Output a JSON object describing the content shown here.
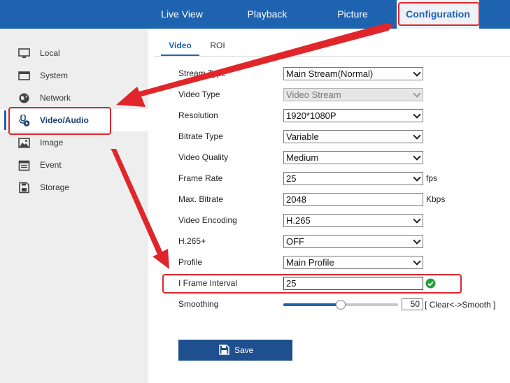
{
  "topnav": {
    "items": [
      {
        "label": "Live View"
      },
      {
        "label": "Playback"
      },
      {
        "label": "Picture"
      },
      {
        "label": "Configuration"
      }
    ]
  },
  "sidebar": {
    "items": [
      {
        "label": "Local",
        "icon": "monitor-icon"
      },
      {
        "label": "System",
        "icon": "system-window-icon"
      },
      {
        "label": "Network",
        "icon": "globe-icon"
      },
      {
        "label": "Video/Audio",
        "icon": "video-audio-icon"
      },
      {
        "label": "Image",
        "icon": "image-icon"
      },
      {
        "label": "Event",
        "icon": "calendar-icon"
      },
      {
        "label": "Storage",
        "icon": "storage-icon"
      }
    ]
  },
  "tabs": [
    {
      "label": "Video"
    },
    {
      "label": "ROI"
    }
  ],
  "form": {
    "stream_type": {
      "label": "Stream Type",
      "value": "Main Stream(Normal)"
    },
    "video_type": {
      "label": "Video Type",
      "value": "Video Stream"
    },
    "resolution": {
      "label": "Resolution",
      "value": "1920*1080P"
    },
    "bitrate_type": {
      "label": "Bitrate Type",
      "value": "Variable"
    },
    "video_quality": {
      "label": "Video Quality",
      "value": "Medium"
    },
    "frame_rate": {
      "label": "Frame Rate",
      "value": "25",
      "unit": "fps"
    },
    "max_bitrate": {
      "label": "Max. Bitrate",
      "value": "2048",
      "unit": "Kbps"
    },
    "video_encoding": {
      "label": "Video Encoding",
      "value": "H.265"
    },
    "h265plus": {
      "label": "H.265+",
      "value": "OFF"
    },
    "profile": {
      "label": "Profile",
      "value": "Main Profile"
    },
    "i_frame_interval": {
      "label": "I Frame Interval",
      "value": "25"
    },
    "smoothing": {
      "label": "Smoothing",
      "value": "50",
      "hint": "[ Clear<->Smooth ]",
      "level_fraction": 0.5
    }
  },
  "save_label": "Save",
  "colors": {
    "nav_blue": "#1e63b0",
    "highlight_red": "#e0262b",
    "ok_green": "#22a33a",
    "save_blue": "#1e4f8f"
  }
}
